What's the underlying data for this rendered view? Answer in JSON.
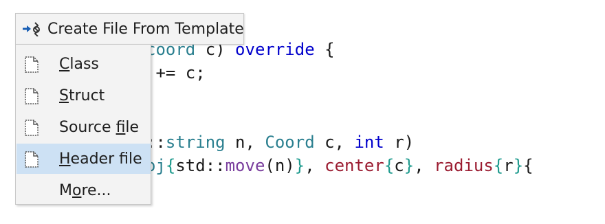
{
  "code": {
    "line1": {
      "punct1": "coord",
      "punct2": " c) ",
      "kw": "override",
      "rest": " {"
    },
    "line2": {
      "text": " += c;"
    },
    "line3": {
      "scope": "::",
      "type": "string",
      "a": " n, ",
      "type2": "Coord",
      "b": " c, ",
      "kw": "int",
      "c": " r)"
    },
    "line4": {
      "pre": "oj",
      "br1": "{",
      "std": "std::",
      "fn": "move",
      "mid": "(n)",
      "br2": "}",
      "comma": ", ",
      "m1": "center",
      "br3": "{",
      "c": "c",
      "br4": "}",
      "comma2": ", ",
      "m2": "radius",
      "br5": "{",
      "r": "r",
      "br6": "}",
      "br7": "{"
    }
  },
  "popup": {
    "title": "Create File From Template",
    "title_icon": "create-from-template-icon",
    "items": [
      {
        "label": "Class",
        "icon": "file-icon",
        "selected": false
      },
      {
        "label": "Struct",
        "icon": "file-icon",
        "selected": false
      },
      {
        "label": "Source file",
        "icon": "file-icon",
        "selected": false
      },
      {
        "label": "Header file",
        "icon": "file-icon",
        "selected": true
      },
      {
        "label": "More...",
        "icon": "",
        "selected": false
      }
    ]
  },
  "colors": {
    "keyword": "#0000cc",
    "type": "#2a7f8f",
    "function": "#7a3e9d",
    "member": "#9b1c31",
    "brace": "#1f9b8e",
    "selection": "#cde1f4"
  }
}
